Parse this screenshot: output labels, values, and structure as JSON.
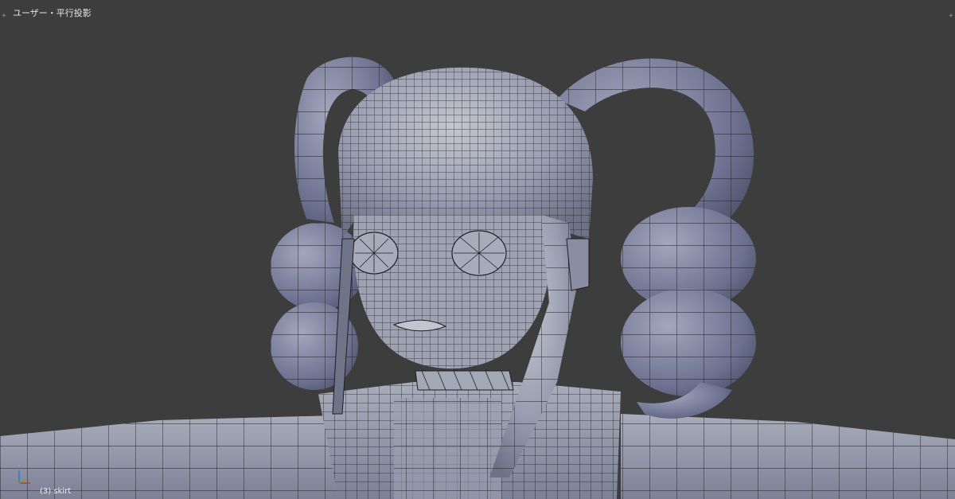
{
  "viewport": {
    "view_label": "ユーザー・平行投影",
    "active_object_label": "(3) skirt",
    "corner_plus": "+"
  },
  "colors": {
    "background": "#3d3d3d",
    "mesh_fill": "#8e93a6",
    "mesh_shadow": "#5b5f74",
    "mesh_highlight": "#b9bcc8",
    "wire": "#1e1e24",
    "axis_x": "#c8343c",
    "axis_y": "#6fa63a",
    "axis_z": "#3a6fd0"
  },
  "icons": {
    "axes_widget": "axes-gizmo-icon"
  }
}
